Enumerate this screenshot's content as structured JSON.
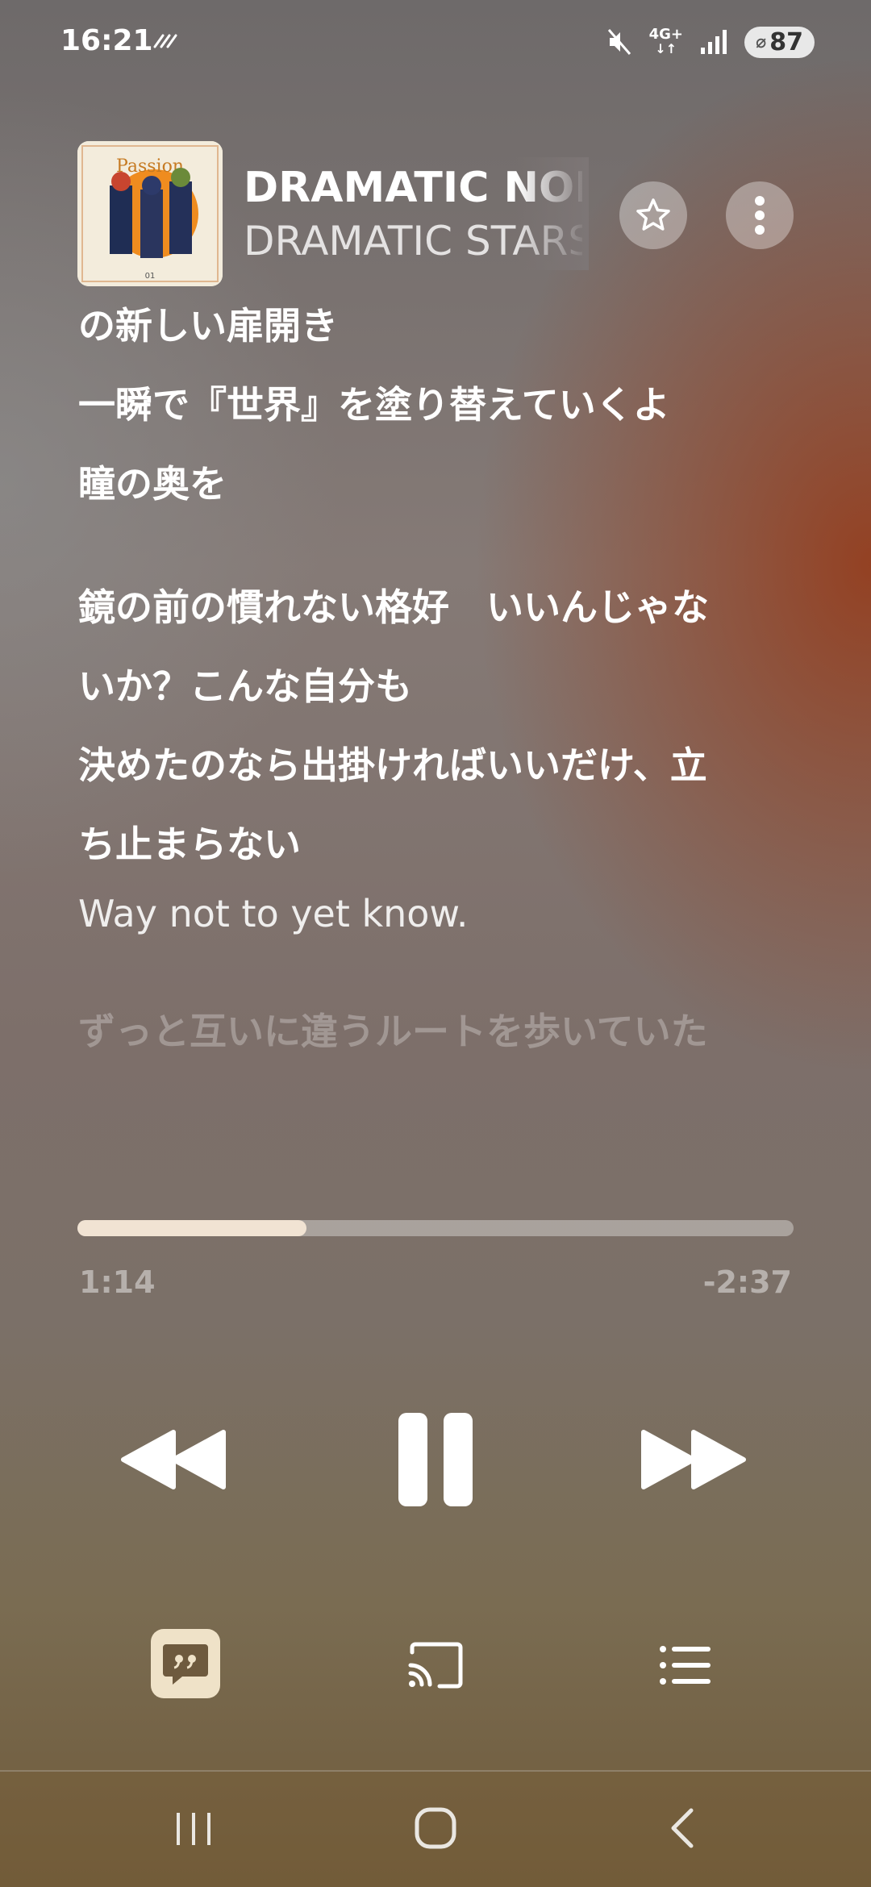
{
  "status": {
    "time": "16:21",
    "network": "4G+",
    "battery": "87",
    "icons": [
      "data-saver-icon",
      "mute-icon",
      "4g-plus-icon",
      "signal-icon",
      "battery-icon"
    ]
  },
  "track": {
    "title": "DRAMATIC NONSENSE",
    "artist": "DRAMATIC STARS"
  },
  "lyrics": {
    "lines": [
      "の新しい扉開き",
      "一瞬で『世界』を塗り替えていくよ",
      "瞳の奥を",
      "",
      "鏡の前の慣れない格好　いいんじゃな",
      "いか？こんな自分も",
      "決めたのなら出掛ければいいだけ、立",
      "ち止まらない"
    ],
    "active_line": "Way not to yet know.",
    "upcoming_line": "ずっと互いに違うルートを歩いていた"
  },
  "playback": {
    "elapsed": "1:14",
    "remaining": "-2:37",
    "progress_fraction": 0.32
  },
  "colors": {
    "accent": "#f1e3d3",
    "lyrics_button_bg": "#efe2c8"
  }
}
